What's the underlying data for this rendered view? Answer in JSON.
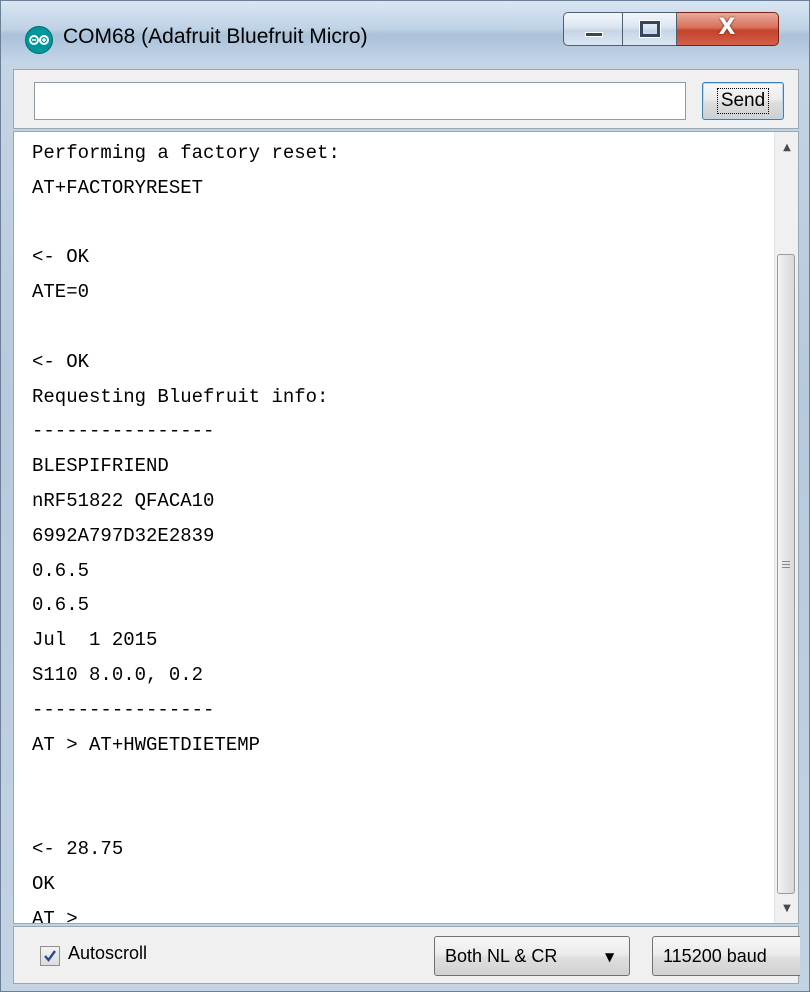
{
  "window": {
    "title": "COM68 (Adafruit Bluefruit Micro)",
    "app_icon": "arduino-infinity-icon",
    "buttons": {
      "minimize": "minimize-icon",
      "maximize": "maximize-icon",
      "close_glyph": "X"
    }
  },
  "send_bar": {
    "input_value": "",
    "send_label": "Send"
  },
  "console": {
    "lines": [
      "Performing a factory reset:",
      "AT+FACTORYRESET",
      "",
      "<- OK",
      "ATE=0",
      "",
      "<- OK",
      "Requesting Bluefruit info:",
      "----------------",
      "BLESPIFRIEND",
      "nRF51822 QFACA10",
      "6992A797D32E2839",
      "0.6.5",
      "0.6.5",
      "Jul  1 2015",
      "S110 8.0.0, 0.2",
      "----------------",
      "AT > AT+HWGETDIETEMP",
      "",
      "",
      "<- 28.75",
      "OK",
      "AT >"
    ]
  },
  "footer": {
    "autoscroll_label": "Autoscroll",
    "autoscroll_checked": true,
    "line_ending_selected": "Both NL & CR",
    "baud_selected": "115200 baud"
  },
  "colors": {
    "arduino_teal": "#00979c",
    "close_red": "#c4422a",
    "focus_blue": "#3c7fb1"
  }
}
